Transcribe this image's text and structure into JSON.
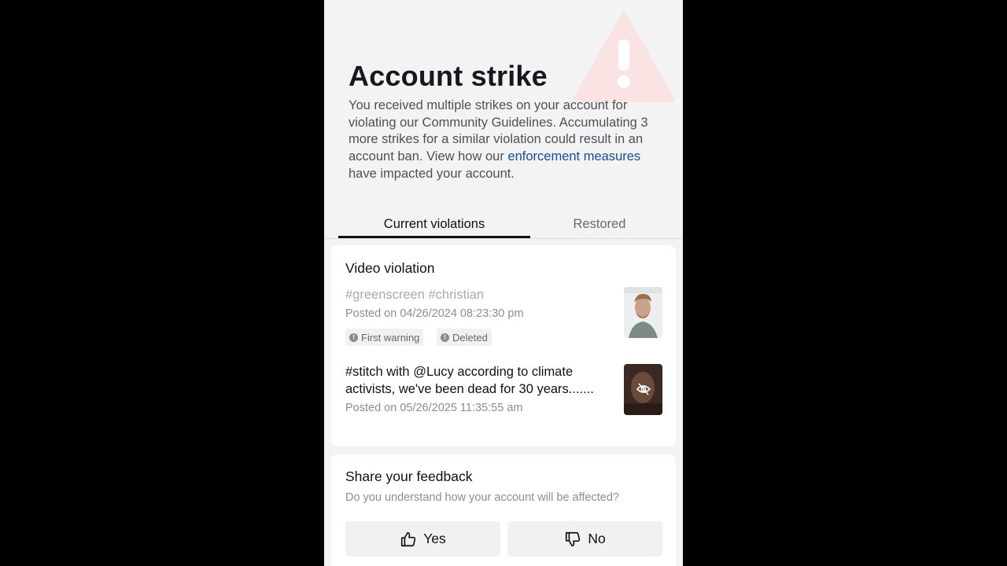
{
  "header": {
    "title": "Account strike",
    "desc_text": "You received multiple strikes on your account for violating our Community Guidelines. Accumulating 3 more strikes for a similar violation could result in an account ban. View how our ",
    "desc_link": "enforcement measures",
    "desc_tail": " have impacted your account."
  },
  "tabs": [
    {
      "label": "Current violations",
      "active": true
    },
    {
      "label": "Restored",
      "active": false
    }
  ],
  "violations": {
    "title": "Video violation",
    "items": [
      {
        "caption": "#greenscreen #christian",
        "posted": "Posted on 04/26/2024 08:23:30 pm",
        "badges": [
          "First warning",
          "Deleted"
        ]
      },
      {
        "caption": "#stitch with @Lucy according to climate activists, we've been dead for 30 years.......",
        "posted": "Posted on 05/26/2025 11:35:55 am"
      }
    ]
  },
  "feedback": {
    "title": "Share your feedback",
    "question": "Do you understand how your account will be affected?",
    "yes_label": "Yes",
    "no_label": "No"
  },
  "colors": {
    "link": "#1a4aa0",
    "page_bg": "#f3f3f3",
    "warning_bg_icon": "#f9e3e3"
  },
  "icons": {
    "background": "warning-triangle-icon",
    "badge": "exclamation-circle-icon",
    "hidden": "eye-slash-icon",
    "yes": "thumbs-up-icon",
    "no": "thumbs-down-icon"
  }
}
